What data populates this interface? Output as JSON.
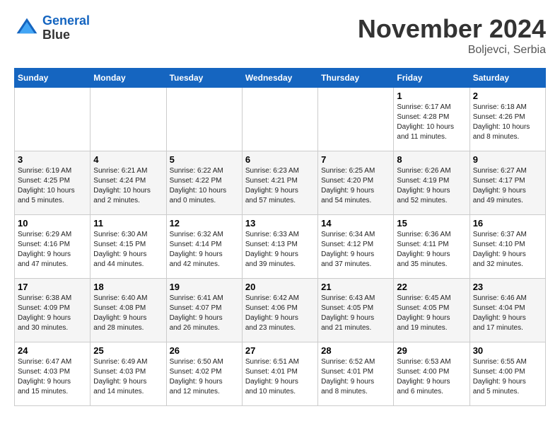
{
  "logo": {
    "line1": "General",
    "line2": "Blue"
  },
  "title": "November 2024",
  "location": "Boljevci, Serbia",
  "weekdays": [
    "Sunday",
    "Monday",
    "Tuesday",
    "Wednesday",
    "Thursday",
    "Friday",
    "Saturday"
  ],
  "weeks": [
    [
      {
        "day": "",
        "info": ""
      },
      {
        "day": "",
        "info": ""
      },
      {
        "day": "",
        "info": ""
      },
      {
        "day": "",
        "info": ""
      },
      {
        "day": "",
        "info": ""
      },
      {
        "day": "1",
        "info": "Sunrise: 6:17 AM\nSunset: 4:28 PM\nDaylight: 10 hours\nand 11 minutes."
      },
      {
        "day": "2",
        "info": "Sunrise: 6:18 AM\nSunset: 4:26 PM\nDaylight: 10 hours\nand 8 minutes."
      }
    ],
    [
      {
        "day": "3",
        "info": "Sunrise: 6:19 AM\nSunset: 4:25 PM\nDaylight: 10 hours\nand 5 minutes."
      },
      {
        "day": "4",
        "info": "Sunrise: 6:21 AM\nSunset: 4:24 PM\nDaylight: 10 hours\nand 2 minutes."
      },
      {
        "day": "5",
        "info": "Sunrise: 6:22 AM\nSunset: 4:22 PM\nDaylight: 10 hours\nand 0 minutes."
      },
      {
        "day": "6",
        "info": "Sunrise: 6:23 AM\nSunset: 4:21 PM\nDaylight: 9 hours\nand 57 minutes."
      },
      {
        "day": "7",
        "info": "Sunrise: 6:25 AM\nSunset: 4:20 PM\nDaylight: 9 hours\nand 54 minutes."
      },
      {
        "day": "8",
        "info": "Sunrise: 6:26 AM\nSunset: 4:19 PM\nDaylight: 9 hours\nand 52 minutes."
      },
      {
        "day": "9",
        "info": "Sunrise: 6:27 AM\nSunset: 4:17 PM\nDaylight: 9 hours\nand 49 minutes."
      }
    ],
    [
      {
        "day": "10",
        "info": "Sunrise: 6:29 AM\nSunset: 4:16 PM\nDaylight: 9 hours\nand 47 minutes."
      },
      {
        "day": "11",
        "info": "Sunrise: 6:30 AM\nSunset: 4:15 PM\nDaylight: 9 hours\nand 44 minutes."
      },
      {
        "day": "12",
        "info": "Sunrise: 6:32 AM\nSunset: 4:14 PM\nDaylight: 9 hours\nand 42 minutes."
      },
      {
        "day": "13",
        "info": "Sunrise: 6:33 AM\nSunset: 4:13 PM\nDaylight: 9 hours\nand 39 minutes."
      },
      {
        "day": "14",
        "info": "Sunrise: 6:34 AM\nSunset: 4:12 PM\nDaylight: 9 hours\nand 37 minutes."
      },
      {
        "day": "15",
        "info": "Sunrise: 6:36 AM\nSunset: 4:11 PM\nDaylight: 9 hours\nand 35 minutes."
      },
      {
        "day": "16",
        "info": "Sunrise: 6:37 AM\nSunset: 4:10 PM\nDaylight: 9 hours\nand 32 minutes."
      }
    ],
    [
      {
        "day": "17",
        "info": "Sunrise: 6:38 AM\nSunset: 4:09 PM\nDaylight: 9 hours\nand 30 minutes."
      },
      {
        "day": "18",
        "info": "Sunrise: 6:40 AM\nSunset: 4:08 PM\nDaylight: 9 hours\nand 28 minutes."
      },
      {
        "day": "19",
        "info": "Sunrise: 6:41 AM\nSunset: 4:07 PM\nDaylight: 9 hours\nand 26 minutes."
      },
      {
        "day": "20",
        "info": "Sunrise: 6:42 AM\nSunset: 4:06 PM\nDaylight: 9 hours\nand 23 minutes."
      },
      {
        "day": "21",
        "info": "Sunrise: 6:43 AM\nSunset: 4:05 PM\nDaylight: 9 hours\nand 21 minutes."
      },
      {
        "day": "22",
        "info": "Sunrise: 6:45 AM\nSunset: 4:05 PM\nDaylight: 9 hours\nand 19 minutes."
      },
      {
        "day": "23",
        "info": "Sunrise: 6:46 AM\nSunset: 4:04 PM\nDaylight: 9 hours\nand 17 minutes."
      }
    ],
    [
      {
        "day": "24",
        "info": "Sunrise: 6:47 AM\nSunset: 4:03 PM\nDaylight: 9 hours\nand 15 minutes."
      },
      {
        "day": "25",
        "info": "Sunrise: 6:49 AM\nSunset: 4:03 PM\nDaylight: 9 hours\nand 14 minutes."
      },
      {
        "day": "26",
        "info": "Sunrise: 6:50 AM\nSunset: 4:02 PM\nDaylight: 9 hours\nand 12 minutes."
      },
      {
        "day": "27",
        "info": "Sunrise: 6:51 AM\nSunset: 4:01 PM\nDaylight: 9 hours\nand 10 minutes."
      },
      {
        "day": "28",
        "info": "Sunrise: 6:52 AM\nSunset: 4:01 PM\nDaylight: 9 hours\nand 8 minutes."
      },
      {
        "day": "29",
        "info": "Sunrise: 6:53 AM\nSunset: 4:00 PM\nDaylight: 9 hours\nand 6 minutes."
      },
      {
        "day": "30",
        "info": "Sunrise: 6:55 AM\nSunset: 4:00 PM\nDaylight: 9 hours\nand 5 minutes."
      }
    ]
  ]
}
